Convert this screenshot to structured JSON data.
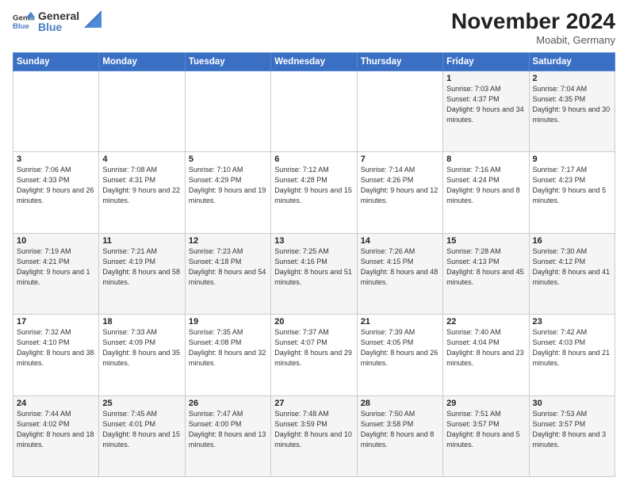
{
  "logo": {
    "general": "General",
    "blue": "Blue"
  },
  "header": {
    "month": "November 2024",
    "location": "Moabit, Germany"
  },
  "weekdays": [
    "Sunday",
    "Monday",
    "Tuesday",
    "Wednesday",
    "Thursday",
    "Friday",
    "Saturday"
  ],
  "weeks": [
    [
      {
        "day": "",
        "info": ""
      },
      {
        "day": "",
        "info": ""
      },
      {
        "day": "",
        "info": ""
      },
      {
        "day": "",
        "info": ""
      },
      {
        "day": "",
        "info": ""
      },
      {
        "day": "1",
        "info": "Sunrise: 7:03 AM\nSunset: 4:37 PM\nDaylight: 9 hours and 34 minutes."
      },
      {
        "day": "2",
        "info": "Sunrise: 7:04 AM\nSunset: 4:35 PM\nDaylight: 9 hours and 30 minutes."
      }
    ],
    [
      {
        "day": "3",
        "info": "Sunrise: 7:06 AM\nSunset: 4:33 PM\nDaylight: 9 hours and 26 minutes."
      },
      {
        "day": "4",
        "info": "Sunrise: 7:08 AM\nSunset: 4:31 PM\nDaylight: 9 hours and 22 minutes."
      },
      {
        "day": "5",
        "info": "Sunrise: 7:10 AM\nSunset: 4:29 PM\nDaylight: 9 hours and 19 minutes."
      },
      {
        "day": "6",
        "info": "Sunrise: 7:12 AM\nSunset: 4:28 PM\nDaylight: 9 hours and 15 minutes."
      },
      {
        "day": "7",
        "info": "Sunrise: 7:14 AM\nSunset: 4:26 PM\nDaylight: 9 hours and 12 minutes."
      },
      {
        "day": "8",
        "info": "Sunrise: 7:16 AM\nSunset: 4:24 PM\nDaylight: 9 hours and 8 minutes."
      },
      {
        "day": "9",
        "info": "Sunrise: 7:17 AM\nSunset: 4:23 PM\nDaylight: 9 hours and 5 minutes."
      }
    ],
    [
      {
        "day": "10",
        "info": "Sunrise: 7:19 AM\nSunset: 4:21 PM\nDaylight: 9 hours and 1 minute."
      },
      {
        "day": "11",
        "info": "Sunrise: 7:21 AM\nSunset: 4:19 PM\nDaylight: 8 hours and 58 minutes."
      },
      {
        "day": "12",
        "info": "Sunrise: 7:23 AM\nSunset: 4:18 PM\nDaylight: 8 hours and 54 minutes."
      },
      {
        "day": "13",
        "info": "Sunrise: 7:25 AM\nSunset: 4:16 PM\nDaylight: 8 hours and 51 minutes."
      },
      {
        "day": "14",
        "info": "Sunrise: 7:26 AM\nSunset: 4:15 PM\nDaylight: 8 hours and 48 minutes."
      },
      {
        "day": "15",
        "info": "Sunrise: 7:28 AM\nSunset: 4:13 PM\nDaylight: 8 hours and 45 minutes."
      },
      {
        "day": "16",
        "info": "Sunrise: 7:30 AM\nSunset: 4:12 PM\nDaylight: 8 hours and 41 minutes."
      }
    ],
    [
      {
        "day": "17",
        "info": "Sunrise: 7:32 AM\nSunset: 4:10 PM\nDaylight: 8 hours and 38 minutes."
      },
      {
        "day": "18",
        "info": "Sunrise: 7:33 AM\nSunset: 4:09 PM\nDaylight: 8 hours and 35 minutes."
      },
      {
        "day": "19",
        "info": "Sunrise: 7:35 AM\nSunset: 4:08 PM\nDaylight: 8 hours and 32 minutes."
      },
      {
        "day": "20",
        "info": "Sunrise: 7:37 AM\nSunset: 4:07 PM\nDaylight: 8 hours and 29 minutes."
      },
      {
        "day": "21",
        "info": "Sunrise: 7:39 AM\nSunset: 4:05 PM\nDaylight: 8 hours and 26 minutes."
      },
      {
        "day": "22",
        "info": "Sunrise: 7:40 AM\nSunset: 4:04 PM\nDaylight: 8 hours and 23 minutes."
      },
      {
        "day": "23",
        "info": "Sunrise: 7:42 AM\nSunset: 4:03 PM\nDaylight: 8 hours and 21 minutes."
      }
    ],
    [
      {
        "day": "24",
        "info": "Sunrise: 7:44 AM\nSunset: 4:02 PM\nDaylight: 8 hours and 18 minutes."
      },
      {
        "day": "25",
        "info": "Sunrise: 7:45 AM\nSunset: 4:01 PM\nDaylight: 8 hours and 15 minutes."
      },
      {
        "day": "26",
        "info": "Sunrise: 7:47 AM\nSunset: 4:00 PM\nDaylight: 8 hours and 13 minutes."
      },
      {
        "day": "27",
        "info": "Sunrise: 7:48 AM\nSunset: 3:59 PM\nDaylight: 8 hours and 10 minutes."
      },
      {
        "day": "28",
        "info": "Sunrise: 7:50 AM\nSunset: 3:58 PM\nDaylight: 8 hours and 8 minutes."
      },
      {
        "day": "29",
        "info": "Sunrise: 7:51 AM\nSunset: 3:57 PM\nDaylight: 8 hours and 5 minutes."
      },
      {
        "day": "30",
        "info": "Sunrise: 7:53 AM\nSunset: 3:57 PM\nDaylight: 8 hours and 3 minutes."
      }
    ]
  ]
}
